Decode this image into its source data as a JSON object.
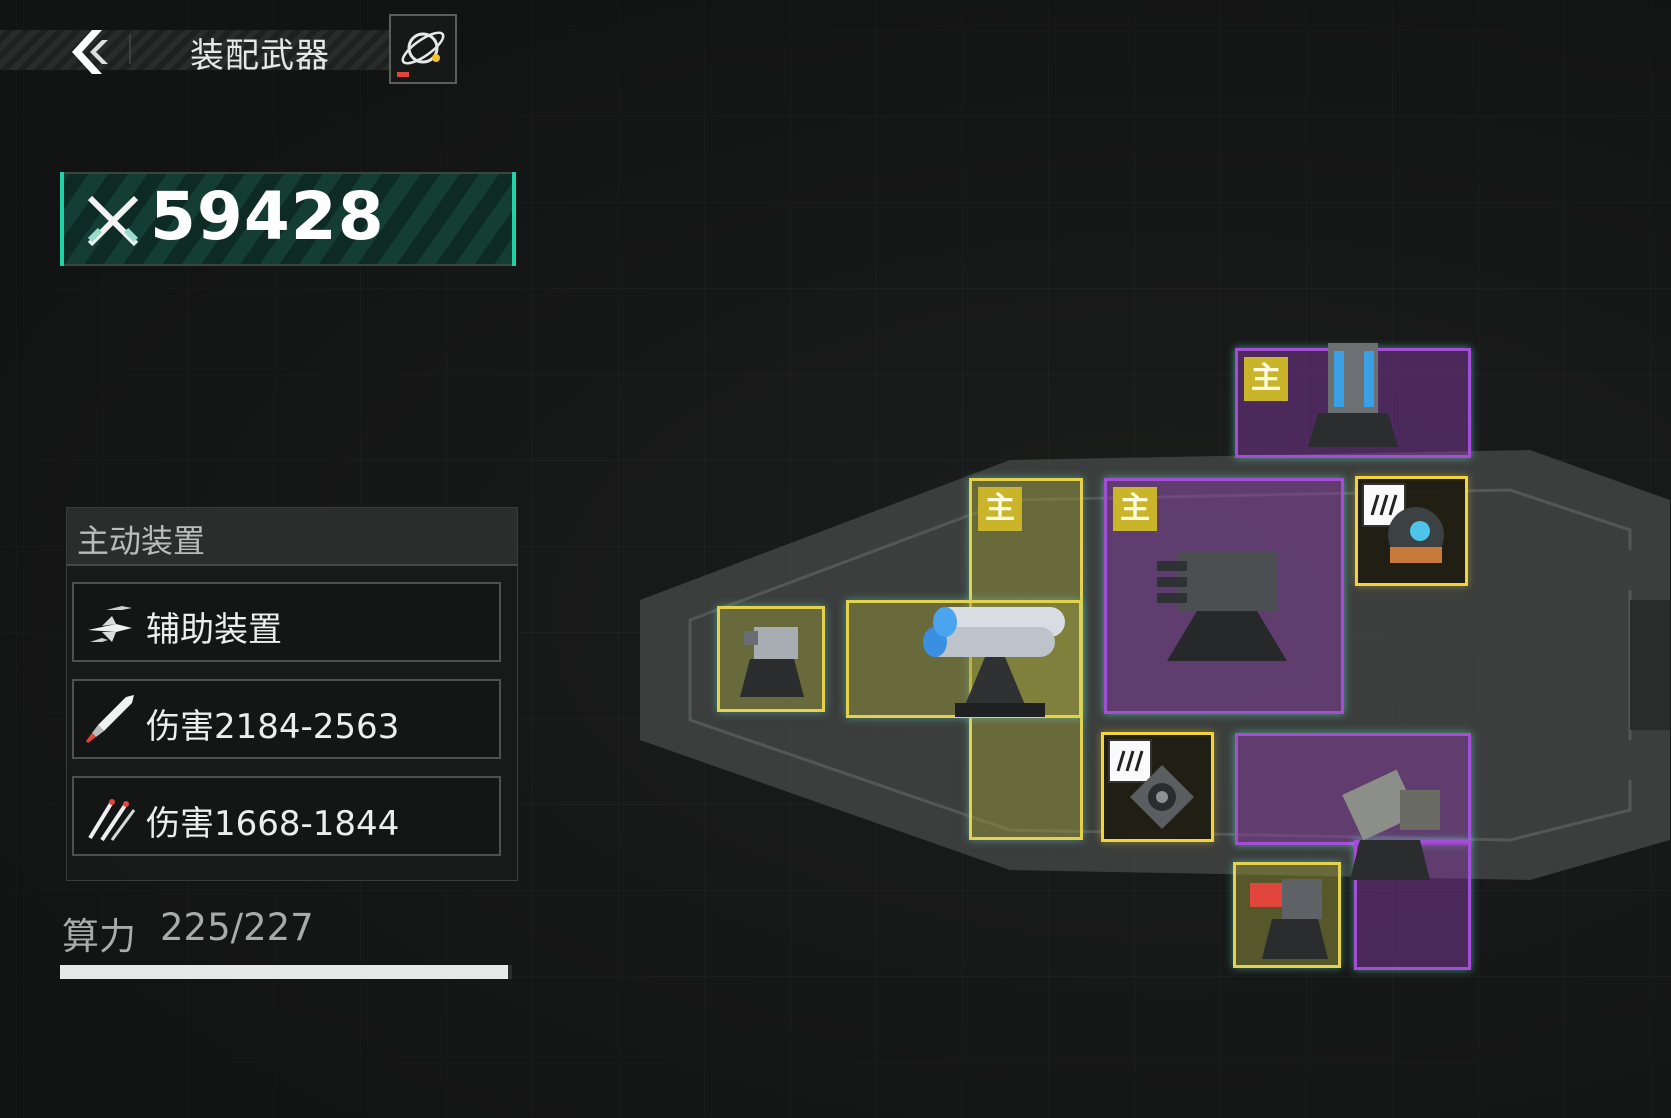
{
  "header": {
    "title": "装配武器"
  },
  "power": {
    "value": "59428"
  },
  "device_panel": {
    "title": "主动装置",
    "items": [
      {
        "label": "辅助装置",
        "icon": "fighter-squad-icon"
      },
      {
        "label": "伤害2184-2563",
        "icon": "missile-icon"
      },
      {
        "label": "伤害1668-1844",
        "icon": "missile-barrage-icon"
      }
    ]
  },
  "compute": {
    "label": "算力",
    "used": "225",
    "total": "227",
    "value": "225/227",
    "fill_fraction": 0.991
  },
  "slots": {
    "main_badge": "主"
  },
  "colors": {
    "accent": "#1fd2a8",
    "purple_slot": "#a24fd6",
    "yellow_slot": "#e5d24c"
  }
}
